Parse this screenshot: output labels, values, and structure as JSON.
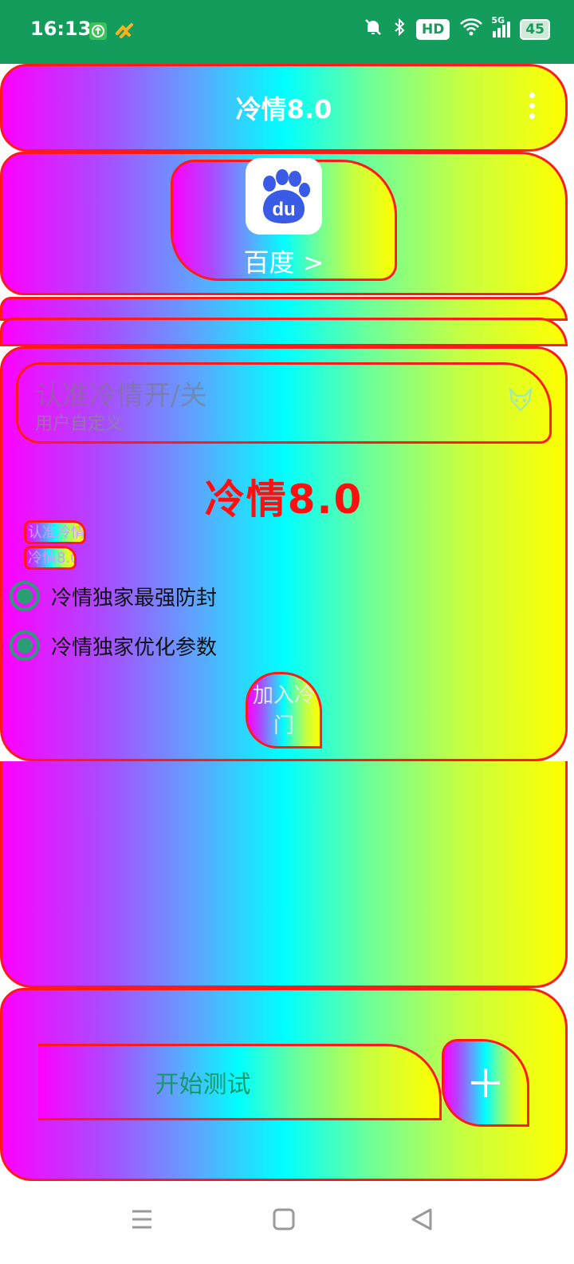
{
  "status_bar": {
    "time": "16:13",
    "battery": "45",
    "network": "5G",
    "hd": "HD",
    "icons": [
      "upload-icon",
      "app-badge-icon",
      "bell-muted-icon",
      "bluetooth-icon",
      "hd-icon",
      "wifi-icon",
      "signal-icon",
      "battery-icon"
    ]
  },
  "app_bar": {
    "title": "冷情8.0",
    "menu_icon": "more-vertical-icon"
  },
  "app_selector": {
    "label": "百度 >",
    "logo_text": "du",
    "logo_icon": "baidu-paw-icon"
  },
  "input": {
    "value": "认准冷情开/关",
    "hint": "用户自定义",
    "icon": "fox-icon"
  },
  "main": {
    "title": "冷情8.0",
    "chip_1": "认准冷情",
    "chip_2": "冷情8.0",
    "options": [
      {
        "label": "冷情独家最强防封",
        "checked": true
      },
      {
        "label": "冷情独家优化参数",
        "checked": true
      }
    ],
    "join_button": "加入冷门"
  },
  "bottom": {
    "start_button": "开始测试",
    "add_icon": "plus-icon"
  },
  "nav": {
    "icons": [
      "menu-icon",
      "home-square-icon",
      "back-triangle-icon"
    ]
  },
  "colors": {
    "status_bar": "#149c5c",
    "accent_red": "#ff1a1a",
    "radio_green": "#2a9d74"
  }
}
